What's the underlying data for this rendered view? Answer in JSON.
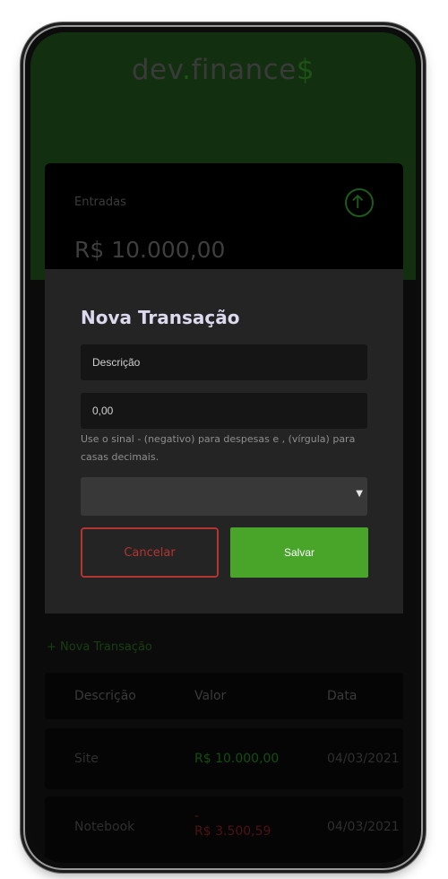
{
  "header": {
    "logo_part1": "dev",
    "logo_dot": ".",
    "logo_part2": "finance",
    "logo_dollar": "$"
  },
  "income_card": {
    "label": "Entradas",
    "amount": "R$ 10.000,00",
    "icon": "arrow-up-circle-icon"
  },
  "new_transaction_link": "+ Nova Transação",
  "table": {
    "headers": [
      "Descrição",
      "Valor",
      "Data"
    ],
    "rows": [
      {
        "description": "Site",
        "value": "R$ 10.000,00",
        "date": "04/03/2021"
      },
      {
        "description": "Notebook",
        "value_sign": "-",
        "value": "R$ 3.500,59",
        "date": "04/03/2021"
      }
    ]
  },
  "modal": {
    "title": "Nova Transação",
    "description_placeholder": "Descrição",
    "value_placeholder": "0,00",
    "help_text": "Use o sinal - (negativo) para despesas e , (vírgula) para casas decimais.",
    "select_value": "",
    "cancel_label": "Cancelar",
    "save_label": "Salvar"
  },
  "colors": {
    "accent_green": "#49a52a",
    "danger_red": "#b33430",
    "modal_bg": "#242424"
  }
}
